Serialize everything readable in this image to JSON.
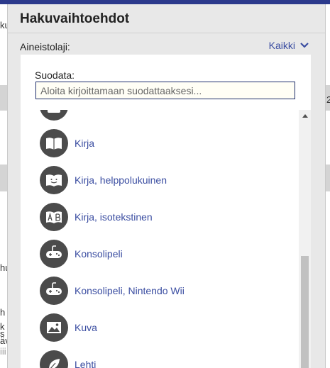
{
  "dialog": {
    "title": "Hakuvaihtoehdot",
    "format_label": "Aineistolaji:",
    "format_value": "Kaikki"
  },
  "filter": {
    "label": "Suodata:",
    "placeholder": "Aloita kirjoittamaan suodattaaksesi..."
  },
  "formats": [
    {
      "label": "",
      "icon": "generic-format-icon"
    },
    {
      "label": "Kirja",
      "icon": "book-icon"
    },
    {
      "label": "Kirja, helppolukuinen",
      "icon": "easy-read-book-icon"
    },
    {
      "label": "Kirja, isotekstinen",
      "icon": "large-print-book-icon"
    },
    {
      "label": "Konsolipeli",
      "icon": "gamepad-icon"
    },
    {
      "label": "Konsolipeli, Nintendo Wii",
      "icon": "gamepad-icon"
    },
    {
      "label": "Kuva",
      "icon": "image-icon"
    },
    {
      "label": "Lehti",
      "icon": "leaf-icon"
    }
  ],
  "background": {
    "fragments": [
      "ku",
      "2",
      "hu",
      "h",
      "k",
      "s",
      "äv",
      "iii"
    ]
  },
  "colors": {
    "top_bar": "#2c3a8c",
    "link": "#3a4da1",
    "icon_circle": "#4b4b4b"
  }
}
